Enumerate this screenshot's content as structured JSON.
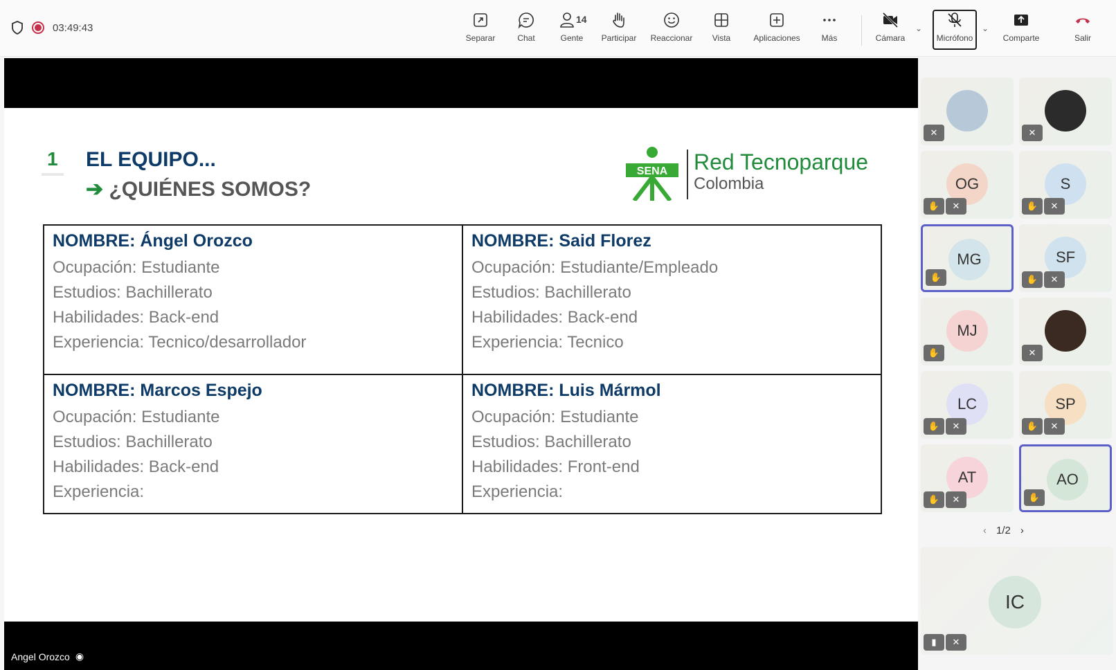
{
  "call": {
    "timer": "03:49:43"
  },
  "toolbar": {
    "separar": "Separar",
    "chat": "Chat",
    "gente": "Gente",
    "gente_count": "14",
    "participar": "Participar",
    "reaccionar": "Reaccionar",
    "vista": "Vista",
    "aplicaciones": "Aplicaciones",
    "mas": "Más",
    "camara": "Cámara",
    "microfono": "Micrófono",
    "comparte": "Comparte",
    "salir": "Salir"
  },
  "slide": {
    "number": "1",
    "title1": "EL EQUIPO...",
    "title2": "¿QUIÉNES SOMOS?",
    "logo_acronym": "SENA",
    "logo_line1": "Red Tecnoparque",
    "logo_line2": "Colombia",
    "members": [
      {
        "name": "NOMBRE: Ángel Orozco",
        "lines": [
          "Ocupación: Estudiante",
          "Estudios: Bachillerato",
          "Habilidades: Back-end",
          "Experiencia: Tecnico/desarrollador"
        ]
      },
      {
        "name": "NOMBRE: Said Florez",
        "lines": [
          "Ocupación: Estudiante/Empleado",
          "Estudios: Bachillerato",
          "Habilidades: Back-end",
          "Experiencia: Tecnico"
        ]
      },
      {
        "name": "NOMBRE: Marcos Espejo",
        "lines": [
          "Ocupación: Estudiante",
          "Estudios: Bachillerato",
          "Habilidades: Back-end",
          "Experiencia:"
        ]
      },
      {
        "name": "NOMBRE: Luis Mármol",
        "lines": [
          "Ocupación: Estudiante",
          "Estudios: Bachillerato",
          "Habilidades: Front-end",
          "Experiencia:"
        ]
      }
    ]
  },
  "presenter": {
    "name": "Angel Orozco"
  },
  "participants": [
    {
      "initials": "",
      "photo": true,
      "color": "#b7c9d8"
    },
    {
      "initials": "",
      "photo": true,
      "color": "#2b2b2b"
    },
    {
      "initials": "OG",
      "color": "#f4d6c8"
    },
    {
      "initials": "S",
      "color": "#cfe0f1"
    },
    {
      "initials": "MG",
      "color": "#d3e5ea"
    },
    {
      "initials": "SF",
      "color": "#cfe2ee"
    },
    {
      "initials": "MJ",
      "color": "#f6d3d3"
    },
    {
      "initials": "",
      "photo": true,
      "color": "#3a2a22"
    },
    {
      "initials": "LC",
      "color": "#dfe0f5"
    },
    {
      "initials": "SP",
      "color": "#f6dfc2"
    },
    {
      "initials": "AT",
      "color": "#f7d3da"
    },
    {
      "initials": "AO",
      "color": "#d4e6d8"
    }
  ],
  "pager": {
    "label": "1/2"
  },
  "spotlight": {
    "initials": "IC"
  }
}
